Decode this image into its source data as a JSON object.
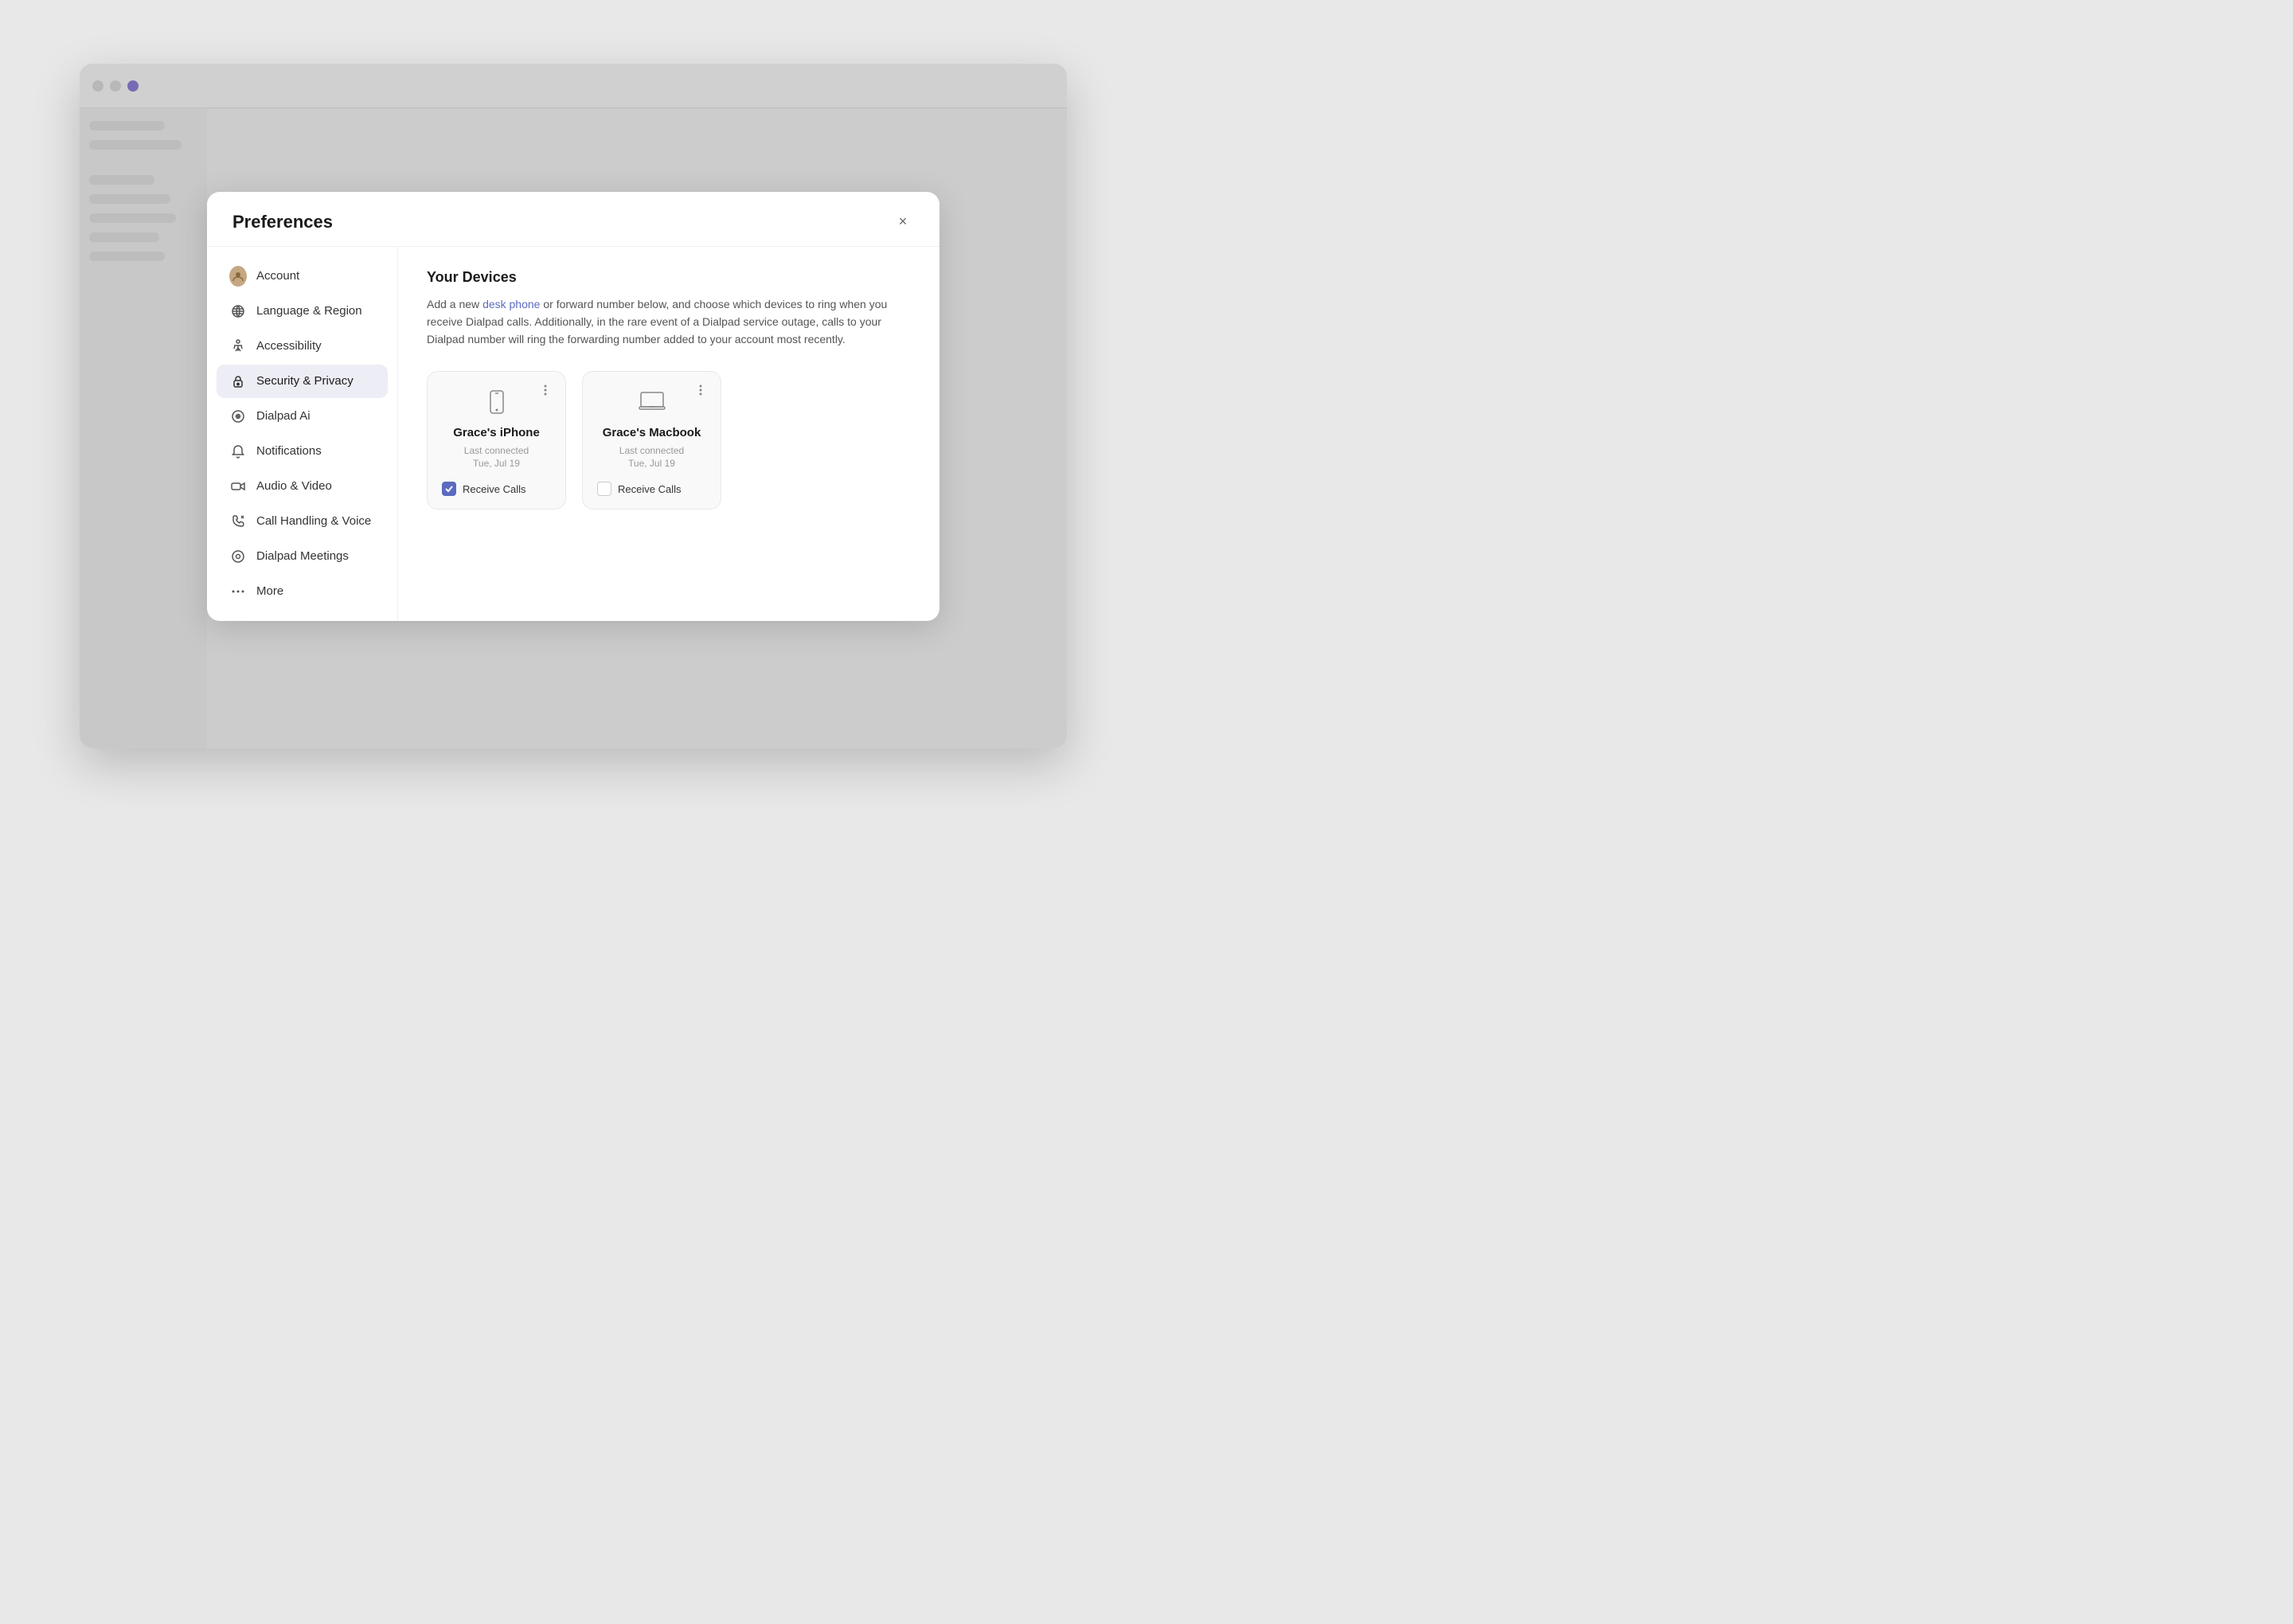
{
  "modal": {
    "title": "Preferences",
    "close_label": "×"
  },
  "nav": {
    "items": [
      {
        "id": "account",
        "label": "Account",
        "icon": "account"
      },
      {
        "id": "language",
        "label": "Language & Region",
        "icon": "language"
      },
      {
        "id": "accessibility",
        "label": "Accessibility",
        "icon": "accessibility"
      },
      {
        "id": "security",
        "label": "Security & Privacy",
        "icon": "security",
        "active": true
      },
      {
        "id": "dialpad-ai",
        "label": "Dialpad Ai",
        "icon": "dialpad-ai"
      },
      {
        "id": "notifications",
        "label": "Notifications",
        "icon": "notifications"
      },
      {
        "id": "audio-video",
        "label": "Audio & Video",
        "icon": "audio-video"
      },
      {
        "id": "call-handling",
        "label": "Call Handling & Voice",
        "icon": "call-handling"
      },
      {
        "id": "dialpad-meetings",
        "label": "Dialpad Meetings",
        "icon": "dialpad-meetings"
      },
      {
        "id": "more",
        "label": "More",
        "icon": "more"
      }
    ]
  },
  "content": {
    "section_title": "Your Devices",
    "description_part1": "Add a new ",
    "desk_phone_link": "desk phone",
    "description_part2": " or forward number below, and choose which devices to ring when you receive Dialpad calls. Additionally, in the rare event of a Dialpad service outage, calls to your Dialpad number will ring the forwarding number added to your account most recently.",
    "devices": [
      {
        "name": "Grace's iPhone",
        "last_connected_label": "Last connected",
        "last_connected_date": "Tue, Jul 19",
        "receive_calls_label": "Receive Calls",
        "receive_calls_checked": true,
        "icon": "phone"
      },
      {
        "name": "Grace's Macbook",
        "last_connected_label": "Last connected",
        "last_connected_date": "Tue, Jul 19",
        "receive_calls_label": "Receive Calls",
        "receive_calls_checked": false,
        "icon": "laptop"
      }
    ]
  },
  "colors": {
    "accent": "#5c6bc0",
    "active_nav_bg": "#ededf5"
  }
}
